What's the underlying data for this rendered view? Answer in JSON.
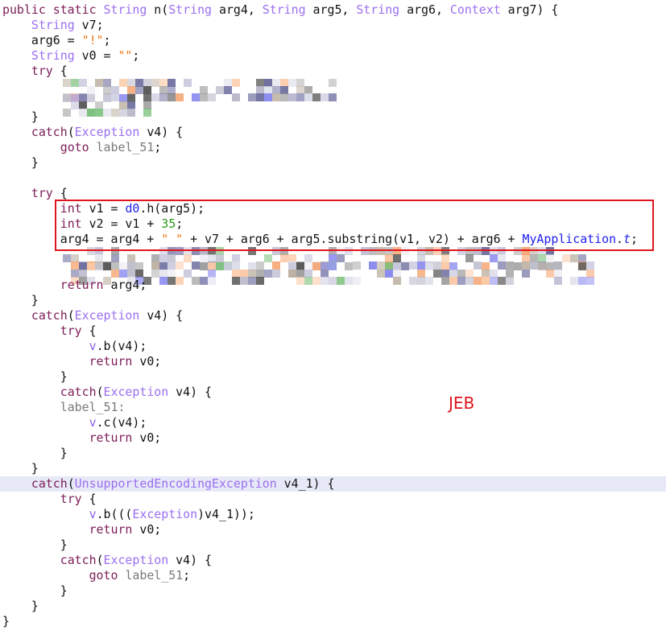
{
  "label": "JEB",
  "colors": {
    "keyword": "#7b1d58",
    "type": "#9b6ff0",
    "string": "#f07818",
    "number": "#2a9a1a",
    "class": "#1f1fee",
    "label": "#7a7a7a",
    "highlight": "#e7e9f8",
    "annotation": "#e0141e"
  },
  "lines": [
    {
      "tokens": [
        [
          "k",
          "public static "
        ],
        [
          "t",
          "String"
        ],
        [
          "p",
          " n("
        ],
        [
          "t",
          "String"
        ],
        [
          "p",
          " arg4, "
        ],
        [
          "t",
          "String"
        ],
        [
          "p",
          " arg5, "
        ],
        [
          "t",
          "String"
        ],
        [
          "p",
          " arg6, "
        ],
        [
          "t",
          "Context"
        ],
        [
          "p",
          " arg7) {"
        ]
      ]
    },
    {
      "tokens": [
        [
          "p",
          "    "
        ],
        [
          "t",
          "String"
        ],
        [
          "p",
          " v7;"
        ]
      ]
    },
    {
      "tokens": [
        [
          "p",
          "    arg6 = "
        ],
        [
          "s",
          "\"!\""
        ],
        [
          "p",
          ";"
        ]
      ]
    },
    {
      "tokens": [
        [
          "p",
          "    "
        ],
        [
          "t",
          "String"
        ],
        [
          "p",
          " v0 = "
        ],
        [
          "s",
          "\"\""
        ],
        [
          "p",
          ";"
        ]
      ]
    },
    {
      "tokens": [
        [
          "p",
          "    "
        ],
        [
          "k",
          "try"
        ],
        [
          "p",
          " {"
        ]
      ]
    },
    {
      "blurred": true,
      "tokens": []
    },
    {
      "blurred": true,
      "tokens": []
    },
    {
      "tokens": [
        [
          "p",
          "    }"
        ]
      ]
    },
    {
      "tokens": [
        [
          "p",
          "    "
        ],
        [
          "k",
          "catch"
        ],
        [
          "p",
          "("
        ],
        [
          "t",
          "Exception"
        ],
        [
          "p",
          " v4) {"
        ]
      ]
    },
    {
      "tokens": [
        [
          "p",
          "        "
        ],
        [
          "k",
          "goto"
        ],
        [
          "p",
          " "
        ],
        [
          "l",
          "label_51"
        ],
        [
          "p",
          ";"
        ]
      ]
    },
    {
      "tokens": [
        [
          "p",
          "    }"
        ]
      ]
    },
    {
      "tokens": []
    },
    {
      "tokens": [
        [
          "p",
          "    "
        ],
        [
          "k",
          "try"
        ],
        [
          "p",
          " {"
        ]
      ]
    },
    {
      "tokens": [
        [
          "p",
          "        "
        ],
        [
          "k",
          "int"
        ],
        [
          "p",
          " v1 = "
        ],
        [
          "c",
          "d0"
        ],
        [
          "p",
          ".h(arg5);"
        ]
      ]
    },
    {
      "tokens": [
        [
          "p",
          "        "
        ],
        [
          "k",
          "int"
        ],
        [
          "p",
          " v2 = v1 + "
        ],
        [
          "n",
          "35"
        ],
        [
          "p",
          ";"
        ]
      ]
    },
    {
      "tokens": [
        [
          "p",
          "        arg4 = arg4 + "
        ],
        [
          "s",
          "\" \""
        ],
        [
          "p",
          " + v7 + arg6 + arg5.substring(v1, v2) + arg6 + "
        ],
        [
          "c",
          "MyApplication"
        ],
        [
          "p",
          "."
        ],
        [
          "ci",
          "t"
        ],
        [
          "p",
          ";"
        ]
      ]
    },
    {
      "blurred": true,
      "tokens": []
    },
    {
      "blurred": true,
      "tokens": []
    },
    {
      "tokens": [
        [
          "p",
          "        "
        ],
        [
          "k",
          "return"
        ],
        [
          "p",
          " arg4;"
        ]
      ]
    },
    {
      "tokens": [
        [
          "p",
          "    }"
        ]
      ]
    },
    {
      "tokens": [
        [
          "p",
          "    "
        ],
        [
          "k",
          "catch"
        ],
        [
          "p",
          "("
        ],
        [
          "t",
          "Exception"
        ],
        [
          "p",
          " v4) {"
        ]
      ]
    },
    {
      "tokens": [
        [
          "p",
          "        "
        ],
        [
          "k",
          "try"
        ],
        [
          "p",
          " {"
        ]
      ]
    },
    {
      "tokens": [
        [
          "p",
          "            "
        ],
        [
          "v",
          "v"
        ],
        [
          "p",
          ".b(v4);"
        ]
      ]
    },
    {
      "tokens": [
        [
          "p",
          "            "
        ],
        [
          "k",
          "return"
        ],
        [
          "p",
          " v0;"
        ]
      ]
    },
    {
      "tokens": [
        [
          "p",
          "        }"
        ]
      ]
    },
    {
      "tokens": [
        [
          "p",
          "        "
        ],
        [
          "k",
          "catch"
        ],
        [
          "p",
          "("
        ],
        [
          "t",
          "Exception"
        ],
        [
          "p",
          " v4) {"
        ]
      ]
    },
    {
      "tokens": [
        [
          "p",
          "        "
        ],
        [
          "l",
          "label_51:"
        ]
      ]
    },
    {
      "tokens": [
        [
          "p",
          "            "
        ],
        [
          "v",
          "v"
        ],
        [
          "p",
          ".c(v4);"
        ]
      ]
    },
    {
      "tokens": [
        [
          "p",
          "            "
        ],
        [
          "k",
          "return"
        ],
        [
          "p",
          " v0;"
        ]
      ]
    },
    {
      "tokens": [
        [
          "p",
          "        }"
        ]
      ]
    },
    {
      "tokens": [
        [
          "p",
          "    }"
        ]
      ]
    },
    {
      "highlighted": true,
      "tokens": [
        [
          "p",
          "    "
        ],
        [
          "k",
          "catch"
        ],
        [
          "p",
          "("
        ],
        [
          "t",
          "UnsupportedEncodingException"
        ],
        [
          "p",
          " v4_1) {"
        ]
      ]
    },
    {
      "tokens": [
        [
          "p",
          "        "
        ],
        [
          "k",
          "try"
        ],
        [
          "p",
          " {"
        ]
      ]
    },
    {
      "tokens": [
        [
          "p",
          "            "
        ],
        [
          "v",
          "v"
        ],
        [
          "p",
          ".b((("
        ],
        [
          "t",
          "Exception"
        ],
        [
          "p",
          ")v4_1));"
        ]
      ]
    },
    {
      "tokens": [
        [
          "p",
          "            "
        ],
        [
          "k",
          "return"
        ],
        [
          "p",
          " v0;"
        ]
      ]
    },
    {
      "tokens": [
        [
          "p",
          "        }"
        ]
      ]
    },
    {
      "tokens": [
        [
          "p",
          "        "
        ],
        [
          "k",
          "catch"
        ],
        [
          "p",
          "("
        ],
        [
          "t",
          "Exception"
        ],
        [
          "p",
          " v4) {"
        ]
      ]
    },
    {
      "tokens": [
        [
          "p",
          "            "
        ],
        [
          "k",
          "goto"
        ],
        [
          "p",
          " "
        ],
        [
          "l",
          "label_51"
        ],
        [
          "p",
          ";"
        ]
      ]
    },
    {
      "tokens": [
        [
          "p",
          "        }"
        ]
      ]
    },
    {
      "tokens": [
        [
          "p",
          "    }"
        ]
      ]
    },
    {
      "tokens": [
        [
          "p",
          "}"
        ]
      ]
    }
  ]
}
